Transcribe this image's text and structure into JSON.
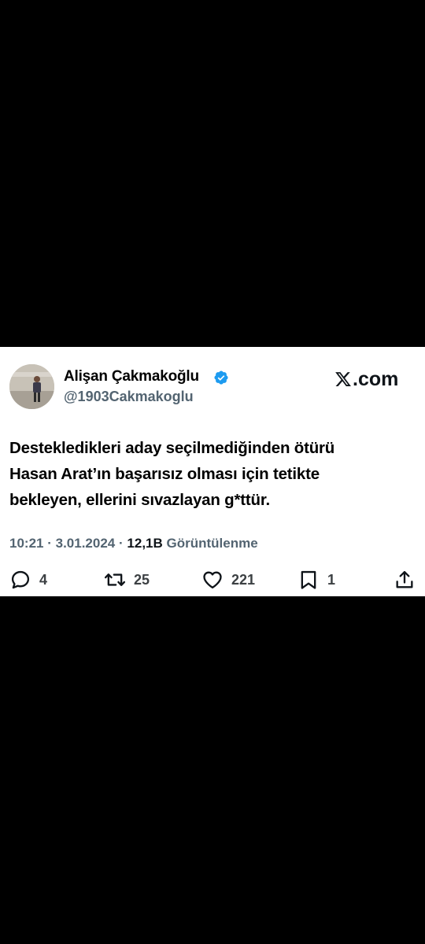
{
  "tweet": {
    "author": {
      "display_name": "Alişan Çakmakoğlu",
      "handle": "@1903Cakmakoglu",
      "verified": true,
      "verified_color": "#1d9bf0"
    },
    "brand": {
      "logo": "x-logo",
      "text": ".com"
    },
    "text_lines": [
      "Destekledikleri aday seçilmediğinden ötürü",
      "Hasan Arat’ın başarısız olması için tetikte",
      "bekleyen, ellerini sıvazlayan g*ttür."
    ],
    "meta": {
      "time": "10:21",
      "separator": "·",
      "date": "3.01.2024",
      "views_count": "12,1B",
      "views_label": "Görüntülenme"
    },
    "actions": {
      "replies": "4",
      "retweets": "25",
      "likes": "221",
      "bookmarks": "1"
    }
  },
  "colors": {
    "background": "#000000",
    "card": "#ffffff",
    "text": "#0f1419",
    "muted": "#536471"
  }
}
